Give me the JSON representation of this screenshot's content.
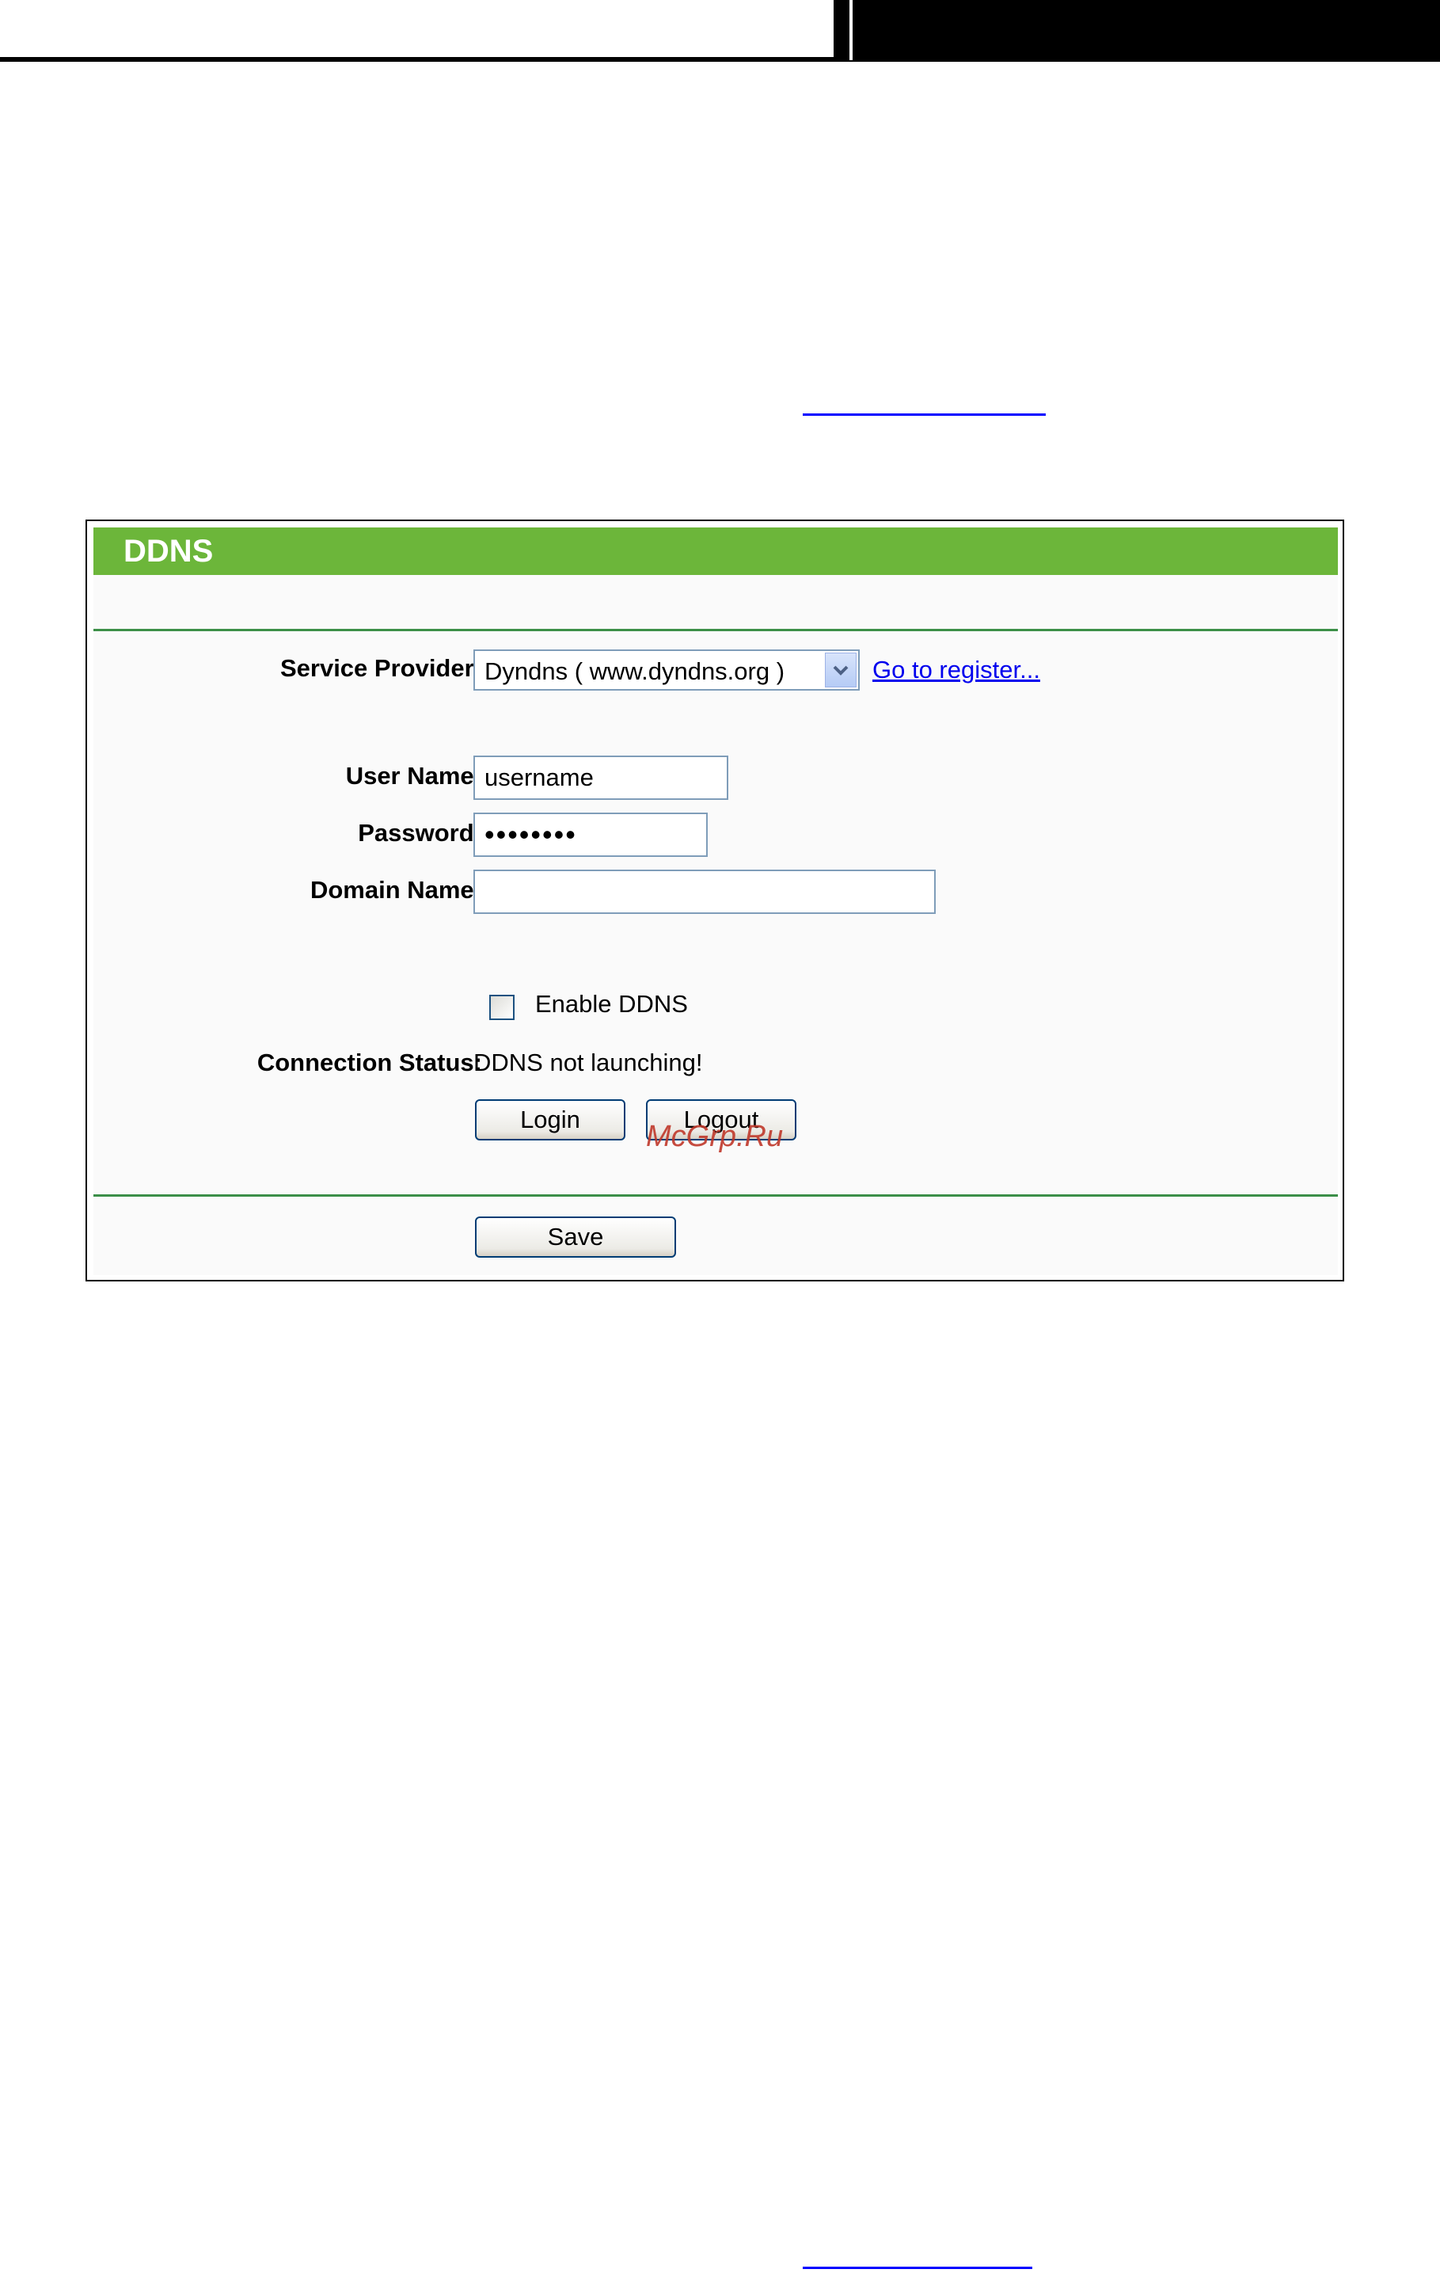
{
  "panel": {
    "title": "DDNS"
  },
  "form": {
    "service_provider": {
      "label": "Service Provider:",
      "selected": "Dyndns ( www.dyndns.org )",
      "register_link": "Go to register..."
    },
    "user_name": {
      "label": "User Name:",
      "value": "username"
    },
    "password": {
      "label": "Password:",
      "value": "password"
    },
    "domain_name": {
      "label": "Domain Name:",
      "value": ""
    },
    "enable_ddns": {
      "label": "Enable DDNS",
      "checked": false
    },
    "connection_status": {
      "label": "Connection Status:",
      "value": "DDNS not launching!"
    },
    "buttons": {
      "login": "Login",
      "logout": "Logout",
      "save": "Save"
    }
  },
  "watermark": "McGrp.Ru",
  "colors": {
    "header_green": "#6cb63a",
    "rule_green": "#3c8f48",
    "link_blue": "#0000ee"
  }
}
